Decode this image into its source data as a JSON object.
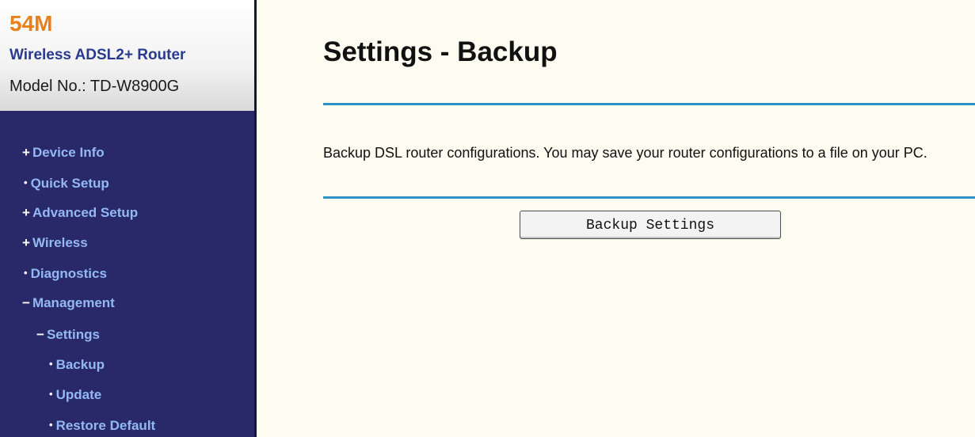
{
  "brand": {
    "speed": "54M",
    "product": "Wireless ADSL2+ Router",
    "model": "Model No.: TD-W8900G"
  },
  "sidebar": {
    "items": [
      {
        "label": "Device Info",
        "marker": "+"
      },
      {
        "label": "Quick Setup",
        "marker": "•"
      },
      {
        "label": "Advanced Setup",
        "marker": "+"
      },
      {
        "label": "Wireless",
        "marker": "+"
      },
      {
        "label": "Diagnostics",
        "marker": "•"
      },
      {
        "label": "Management",
        "marker": "−"
      },
      {
        "label": "Settings",
        "marker": "−"
      },
      {
        "label": "Backup",
        "marker": "•"
      },
      {
        "label": "Update",
        "marker": "•"
      },
      {
        "label": "Restore Default",
        "marker": "•"
      }
    ]
  },
  "main": {
    "title": "Settings - Backup",
    "description": "Backup DSL router configurations. You may save your router configurations to a file on your PC.",
    "button_label": "Backup Settings"
  },
  "colors": {
    "sidebar_bg": "#29296a",
    "nav_text": "#94b8f4",
    "accent_rule": "#2f92c5",
    "brand_orange": "#e8801b",
    "content_bg": "#fdfcf0"
  }
}
